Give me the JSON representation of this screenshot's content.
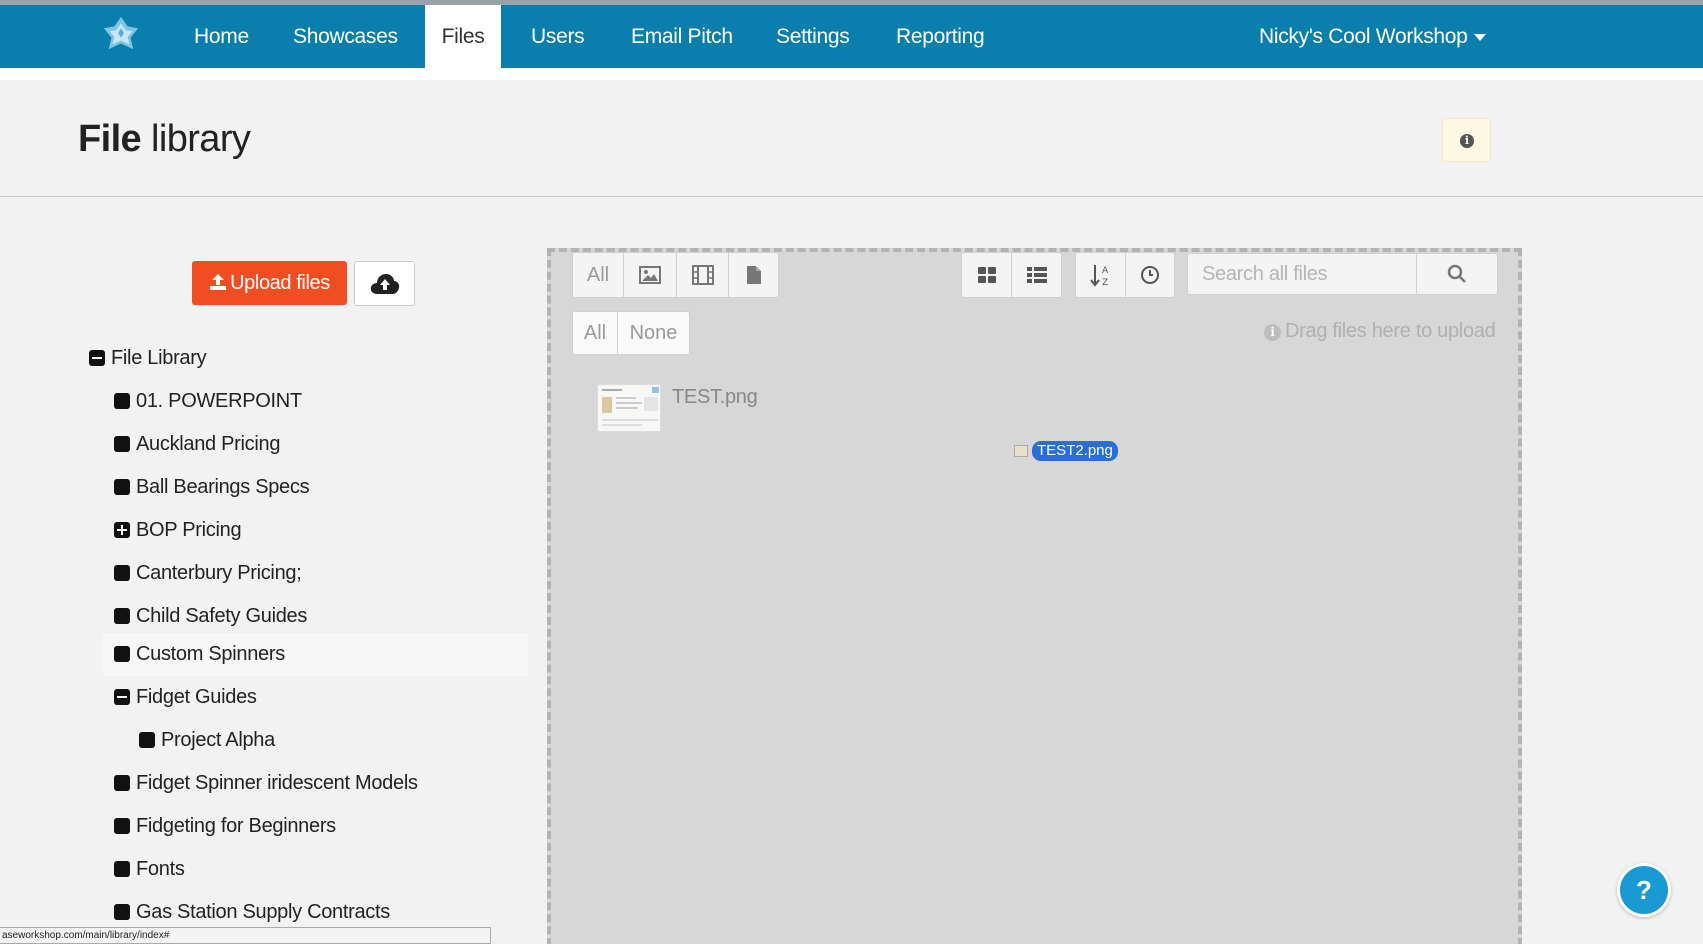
{
  "nav": {
    "items": [
      {
        "label": "Home",
        "active": false
      },
      {
        "label": "Showcases",
        "active": false
      },
      {
        "label": "Files",
        "active": true
      },
      {
        "label": "Users",
        "active": false
      },
      {
        "label": "Email Pitch",
        "active": false
      },
      {
        "label": "Settings",
        "active": false
      },
      {
        "label": "Reporting",
        "active": false
      }
    ],
    "user_menu": "Nicky's Cool Workshop",
    "color": "#0a7fae"
  },
  "header": {
    "title_bold": "File",
    "title_rest": " library"
  },
  "upload": {
    "upload_label": "Upload files",
    "accent": "#f04e22"
  },
  "tree": {
    "items": [
      {
        "label": "File Library",
        "state": "minus"
      },
      {
        "label": "01. POWERPOINT",
        "state": "leaf"
      },
      {
        "label": "Auckland Pricing",
        "state": "leaf"
      },
      {
        "label": "Ball Bearings Specs",
        "state": "leaf"
      },
      {
        "label": "BOP Pricing",
        "state": "plus"
      },
      {
        "label": "Canterbury Pricing;",
        "state": "leaf"
      },
      {
        "label": "Child Safety Guides",
        "state": "leaf"
      },
      {
        "label": "Custom Spinners",
        "state": "leaf",
        "hovered": true
      },
      {
        "label": "Fidget Guides",
        "state": "minus"
      },
      {
        "label": "Project Alpha",
        "state": "leaf"
      },
      {
        "label": "Fidget Spinner iridescent Models",
        "state": "leaf"
      },
      {
        "label": "Fidgeting for Beginners",
        "state": "leaf"
      },
      {
        "label": "Fonts",
        "state": "leaf"
      },
      {
        "label": "Gas Station Supply Contracts",
        "state": "leaf"
      }
    ]
  },
  "toolbar": {
    "filter_all": "All",
    "filter_icons": [
      "image-icon",
      "film-icon",
      "document-icon"
    ],
    "view_icons": [
      "grid-view-icon",
      "list-view-icon"
    ],
    "sort_icons": [
      "sort-alpha-icon",
      "clock-icon"
    ],
    "select_all": "All",
    "select_none": "None",
    "search_placeholder": "Search all files"
  },
  "dropzone": {
    "hint": "Drag files here to upload",
    "files": [
      {
        "name": "TEST.png"
      }
    ],
    "dragging": "TEST2.png"
  },
  "status_url": "aseworkshop.com/main/library/index#",
  "help_label": "?"
}
